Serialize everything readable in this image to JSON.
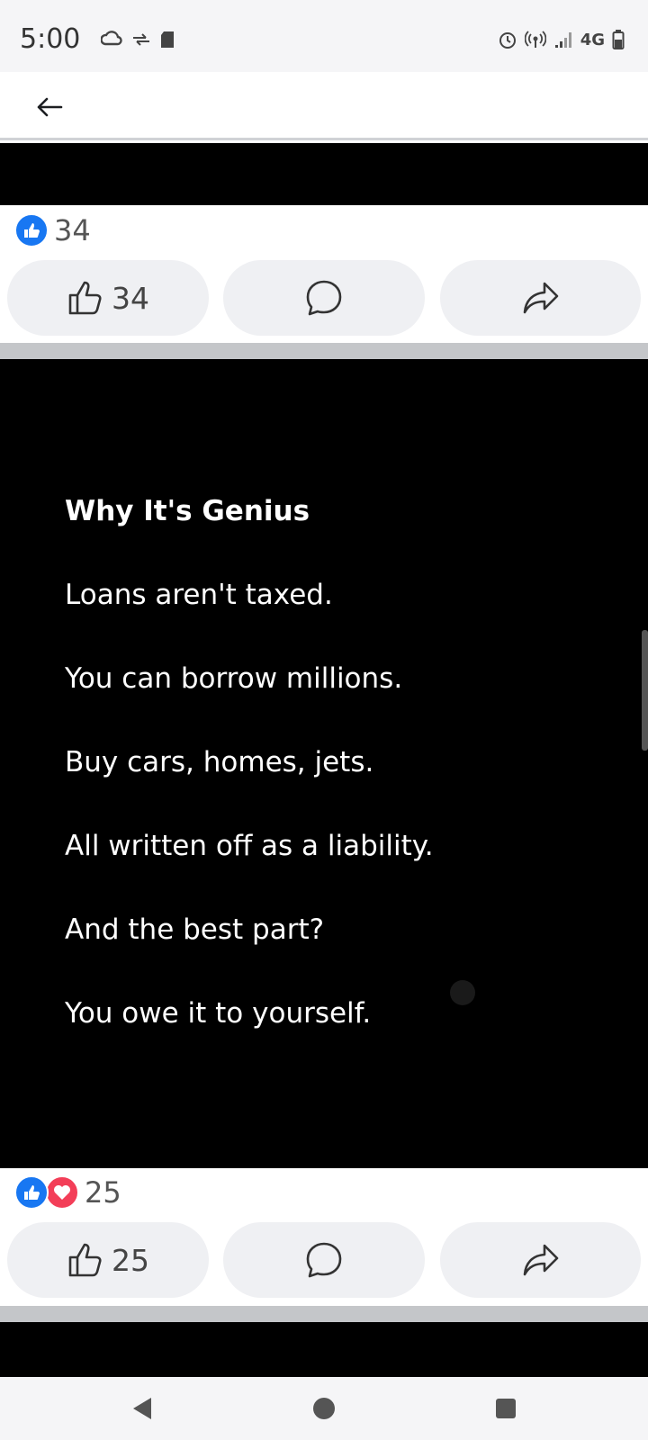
{
  "status_bar": {
    "time": "5:00",
    "network": "4G",
    "left_icons": [
      "cloud-sync-icon",
      "data-transfer-icon",
      "sd-card-icon"
    ],
    "right_icons": [
      "alarm-icon",
      "hotspot-icon",
      "signal-icon",
      "battery-icon"
    ]
  },
  "top_bar": {
    "back_icon": "arrow-left-icon"
  },
  "post1": {
    "reaction_count": "34",
    "like_count": "34"
  },
  "post2": {
    "title": "Why It's Genius",
    "lines": [
      "Loans aren't taxed.",
      "You can borrow millions.",
      "Buy cars, homes, jets.",
      "All written off as a liability.",
      "And the best part?",
      "You owe it to yourself."
    ],
    "reaction_count": "25",
    "like_count": "25"
  },
  "colors": {
    "like_blue": "#1877f2",
    "love_red": "#f33e58",
    "button_bg": "#eff0f3",
    "separator": "#c4c6c9"
  },
  "nav_bar": {
    "icons": [
      "back-triangle-icon",
      "home-circle-icon",
      "recents-square-icon"
    ]
  }
}
